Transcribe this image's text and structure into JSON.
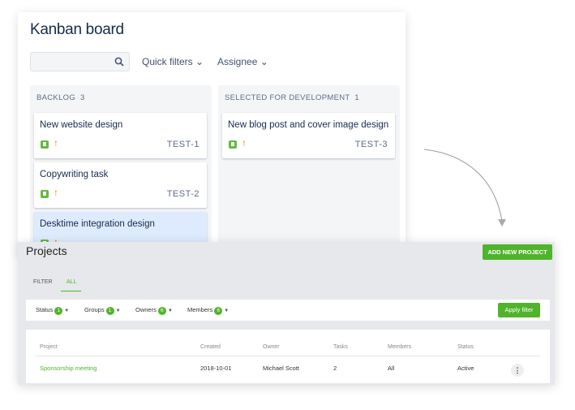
{
  "kanban": {
    "title": "Kanban board",
    "search": {
      "value": "",
      "placeholder": ""
    },
    "quick_filters": "Quick filters",
    "assignee": "Assignee",
    "columns": [
      {
        "name": "BACKLOG",
        "count": "3",
        "cards": [
          {
            "title": "New website design",
            "key": "TEST-1"
          },
          {
            "title": "Copywriting task",
            "key": "TEST-2"
          },
          {
            "title": "Desktime integration design",
            "key": ""
          }
        ]
      },
      {
        "name": "SELECTED FOR DEVELOPMENT",
        "count": "1",
        "cards": [
          {
            "title": "New blog post and cover image design",
            "key": "TEST-3"
          }
        ]
      }
    ]
  },
  "projects": {
    "title": "Projects",
    "add_button": "ADD NEW PROJECT",
    "tabs": [
      "FILTER",
      "ALL"
    ],
    "active_tab": "ALL",
    "filters": [
      {
        "label": "Status",
        "count": "1"
      },
      {
        "label": "Groups",
        "count": "1"
      },
      {
        "label": "Owners",
        "count": "6"
      },
      {
        "label": "Members",
        "count": "6"
      }
    ],
    "apply": "Apply filter",
    "columns": [
      "Project",
      "Created",
      "Owner",
      "Tasks",
      "Members",
      "Status"
    ],
    "rows": [
      {
        "project": "Sponsorship meeting",
        "created": "2018-10-01",
        "owner": "Michael Scott",
        "tasks": "2",
        "members": "All",
        "status": "Active"
      }
    ]
  },
  "colors": {
    "accent_green": "#4fb42b",
    "priority_orange": "#f57c00",
    "selected_card": "#deebff"
  }
}
